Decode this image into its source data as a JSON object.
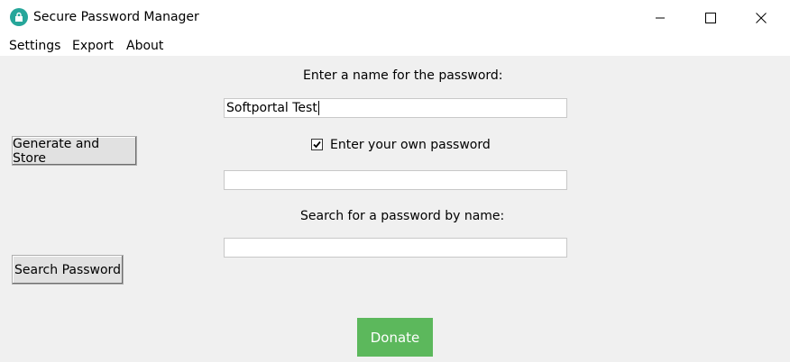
{
  "window": {
    "title": "Secure Password Manager"
  },
  "menu": {
    "settings": "Settings",
    "export": "Export",
    "about": "About"
  },
  "form": {
    "name_label": "Enter a name for the password:",
    "name_value": "Softportal Test",
    "own_password_label": "Enter your own password",
    "own_password_checked": true,
    "password_value": "",
    "search_label": "Search for a password by name:",
    "search_value": ""
  },
  "buttons": {
    "generate": "Generate and Store",
    "search": "Search Password",
    "donate": "Donate"
  },
  "colors": {
    "donate_bg": "#5cb85c",
    "app_icon": "#26a69a"
  }
}
